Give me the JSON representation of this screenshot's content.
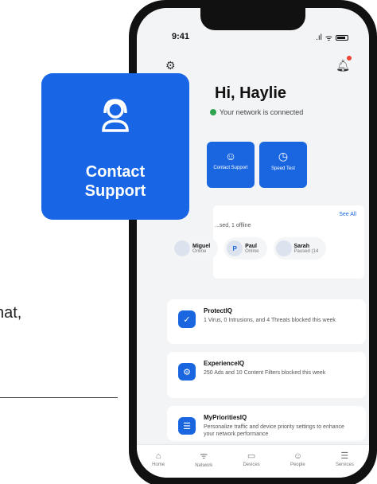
{
  "background": {
    "fragment_text": "hat,"
  },
  "status_bar": {
    "time": "9:41",
    "signal": ".ıl",
    "wifi": "ᯤ"
  },
  "header": {
    "greeting": "Hi, Haylie",
    "network_status": "Your network is connected"
  },
  "quick_actions": [
    {
      "icon": "contact-support-icon",
      "label": "Contact Support"
    },
    {
      "icon": "speed-test-icon",
      "label": "Speed Test"
    }
  ],
  "devices": {
    "see_all": "See All",
    "summary": "...sed, 1 offline",
    "people": [
      {
        "initial": "",
        "name": "Miguel",
        "status": "Online"
      },
      {
        "initial": "P",
        "name": "Paul",
        "status": "Online"
      },
      {
        "initial": "",
        "name": "Sarah",
        "status": "Paused (14"
      }
    ]
  },
  "cards": [
    {
      "icon": "shield-check-icon",
      "title": "ProtectIQ",
      "desc": "1 Virus, 0 Intrusions, and 4 Threats blocked this week"
    },
    {
      "icon": "gear-experience-icon",
      "title": "ExperienceIQ",
      "desc": "250 Ads and 10 Content Filters blocked this week"
    },
    {
      "icon": "priorities-icon",
      "title": "MyPrioritiesIQ",
      "desc": "Personalize traffic and device priority settings to enhance your network performance"
    }
  ],
  "tabbar": [
    {
      "icon": "home-icon",
      "label": "Home"
    },
    {
      "icon": "network-icon",
      "label": "Network"
    },
    {
      "icon": "devices-icon",
      "label": "Devices"
    },
    {
      "icon": "people-icon",
      "label": "People"
    },
    {
      "icon": "services-icon",
      "label": "Services"
    }
  ],
  "overlay": {
    "icon": "contact-support-icon",
    "line1": "Contact",
    "line2": "Support"
  },
  "colors": {
    "brand_blue": "#1866e6",
    "online_green": "#2ea44f",
    "alert_red": "#e43"
  }
}
